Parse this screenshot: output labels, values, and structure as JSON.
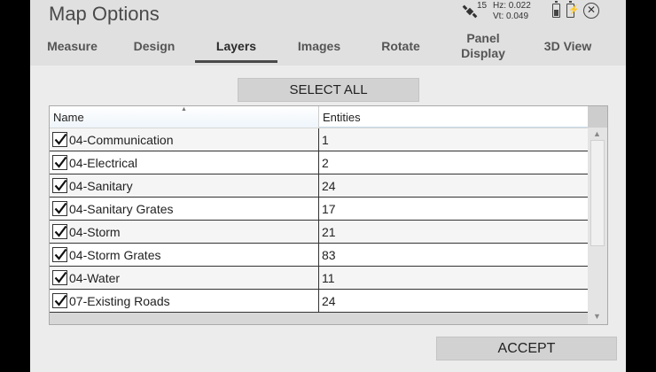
{
  "window": {
    "title": "Map Options"
  },
  "status": {
    "satellites": "15",
    "hz": "Hz: 0.022",
    "vt": "Vt: 0.049",
    "close_icon": "close-icon",
    "colors": {
      "active_tab_underline": "#4a4a4a",
      "button_bg": "#d2d2d2",
      "header_bg": "#e0e0e0"
    }
  },
  "tabs": [
    {
      "label": "Measure"
    },
    {
      "label": "Design"
    },
    {
      "label": "Layers",
      "active": true
    },
    {
      "label": "Images"
    },
    {
      "label": "Rotate"
    },
    {
      "label": "Panel\nDisplay"
    },
    {
      "label": "3D View"
    }
  ],
  "select_all_label": "SELECT ALL",
  "table": {
    "columns": [
      "Name",
      "Entities"
    ],
    "rows": [
      {
        "name": "04-Communication",
        "entities": "1",
        "checked": true
      },
      {
        "name": "04-Electrical",
        "entities": "2",
        "checked": true
      },
      {
        "name": "04-Sanitary",
        "entities": "24",
        "checked": true
      },
      {
        "name": "04-Sanitary Grates",
        "entities": "17",
        "checked": true
      },
      {
        "name": "04-Storm",
        "entities": "21",
        "checked": true
      },
      {
        "name": "04-Storm Grates",
        "entities": "83",
        "checked": true
      },
      {
        "name": "04-Water",
        "entities": "11",
        "checked": true
      },
      {
        "name": "07-Existing Roads",
        "entities": "24",
        "checked": true
      }
    ]
  },
  "accept_label": "ACCEPT"
}
